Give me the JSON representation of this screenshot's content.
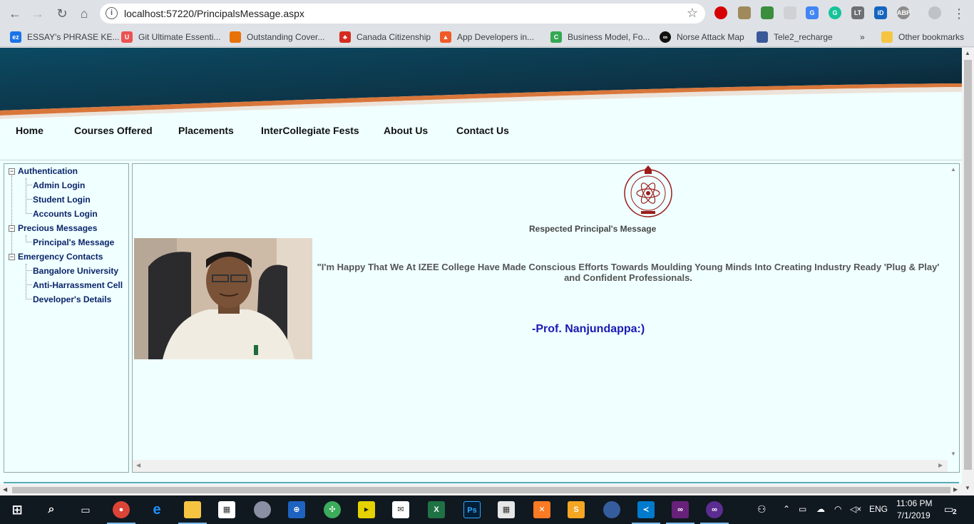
{
  "browser": {
    "url": "localhost:57220/PrincipalsMessage.aspx",
    "bookmarks": [
      {
        "label": "ESSAY's PHRASE KE...",
        "icon": "ez-icon",
        "color": "#1a73e8"
      },
      {
        "label": "Git Ultimate Essenti...",
        "icon": "udemy-icon",
        "color": "#ec5252"
      },
      {
        "label": "Outstanding Cover...",
        "icon": "chart-icon",
        "color": "#e8710a"
      },
      {
        "label": "Canada Citizenship",
        "icon": "maple-leaf-icon",
        "color": "#d52b1e"
      },
      {
        "label": "App Developers in...",
        "icon": "triangle-icon",
        "color": "#f05a28"
      },
      {
        "label": "Business Model, Fo...",
        "icon": "c-icon",
        "color": "#34a853"
      },
      {
        "label": "Norse Attack Map",
        "icon": "norse-icon",
        "color": "#111111"
      },
      {
        "label": "Tele2_recharge",
        "icon": "flag-icon",
        "color": "#3b5998"
      }
    ],
    "more_bookmarks": "»",
    "other_bookmarks": "Other bookmarks"
  },
  "site": {
    "nav": [
      "Home",
      "Courses Offered",
      "Placements",
      "InterCollegiate Fests",
      "About Us",
      "Contact Us"
    ],
    "tree": {
      "groups": [
        {
          "label": "Authentication",
          "items": [
            "Admin Login",
            "Student Login",
            "Accounts Login"
          ]
        },
        {
          "label": "Precious Messages",
          "items": [
            "Principal's Message"
          ]
        },
        {
          "label": "Emergency Contacts",
          "items": [
            "Bangalore University",
            "Anti-Harrassment Cell",
            "Developer's Details"
          ]
        }
      ],
      "collapse_glyph": "−"
    },
    "content": {
      "heading": "Respected Principal's Message",
      "quote": "\"I'm Happy That We At IZEE College Have Made Conscious Efforts Towards Moulding Young Minds Into Creating Industry Ready 'Plug & Play' and  Confident  Professionals.",
      "signature": "-Prof. Nanjundappa:)"
    },
    "colors": {
      "page_bg": "#f0ffff",
      "tree_link": "#0a246a",
      "signature": "#1a1ab5",
      "banner_dark": "#0d3447",
      "banner_curve": "#d9773b"
    }
  },
  "taskbar": {
    "time": "11:06 PM",
    "date": "7/1/2019",
    "language": "ENG",
    "notification_count": "2"
  }
}
